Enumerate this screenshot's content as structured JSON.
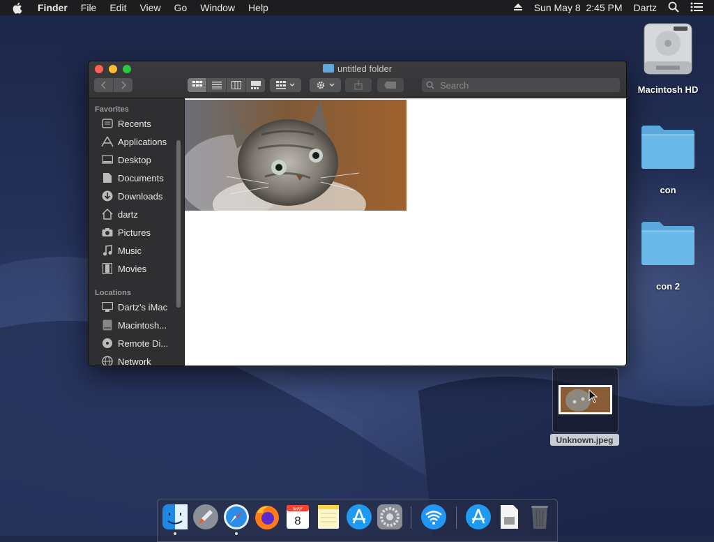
{
  "menubar": {
    "app": "Finder",
    "items": [
      "File",
      "Edit",
      "View",
      "Go",
      "Window",
      "Help"
    ],
    "datetime": "Sun May 8  2:45 PM",
    "user": "Dartz"
  },
  "window": {
    "title": "untitled folder",
    "search_placeholder": "Search"
  },
  "sidebar": {
    "favorites_label": "Favorites",
    "favorites": [
      {
        "label": "Recents",
        "icon": "clock-icon"
      },
      {
        "label": "Applications",
        "icon": "applications-icon"
      },
      {
        "label": "Desktop",
        "icon": "desktop-icon"
      },
      {
        "label": "Documents",
        "icon": "documents-icon"
      },
      {
        "label": "Downloads",
        "icon": "downloads-icon"
      },
      {
        "label": "dartz",
        "icon": "home-icon"
      },
      {
        "label": "Pictures",
        "icon": "camera-icon"
      },
      {
        "label": "Music",
        "icon": "music-icon"
      },
      {
        "label": "Movies",
        "icon": "film-icon"
      }
    ],
    "locations_label": "Locations",
    "locations": [
      {
        "label": "Dartz's iMac",
        "icon": "imac-icon"
      },
      {
        "label": "Macintosh...",
        "icon": "disk-icon"
      },
      {
        "label": "Remote Di...",
        "icon": "remote-disc-icon"
      },
      {
        "label": "Network",
        "icon": "network-icon"
      }
    ]
  },
  "desktop": {
    "icons": [
      {
        "label": "Macintosh HD",
        "icon": "hard-drive-icon"
      },
      {
        "label": "con",
        "icon": "folder-icon"
      },
      {
        "label": "con 2",
        "icon": "folder-icon"
      }
    ],
    "dragged_file": "Unknown.jpeg"
  },
  "calendar": {
    "month": "MAY",
    "day": "8"
  },
  "dock": {
    "items": [
      "finder-icon",
      "launchpad-icon",
      "safari-icon",
      "firefox-icon",
      "calendar-icon",
      "notes-icon",
      "app-store-icon",
      "system-preferences-icon",
      "wifi-icon",
      "app-store-download-icon",
      "preview-file-icon",
      "trash-icon"
    ]
  },
  "colors": {
    "accent_folder": "#5ea9dd",
    "menubar_bg": "#1d1d1f"
  }
}
